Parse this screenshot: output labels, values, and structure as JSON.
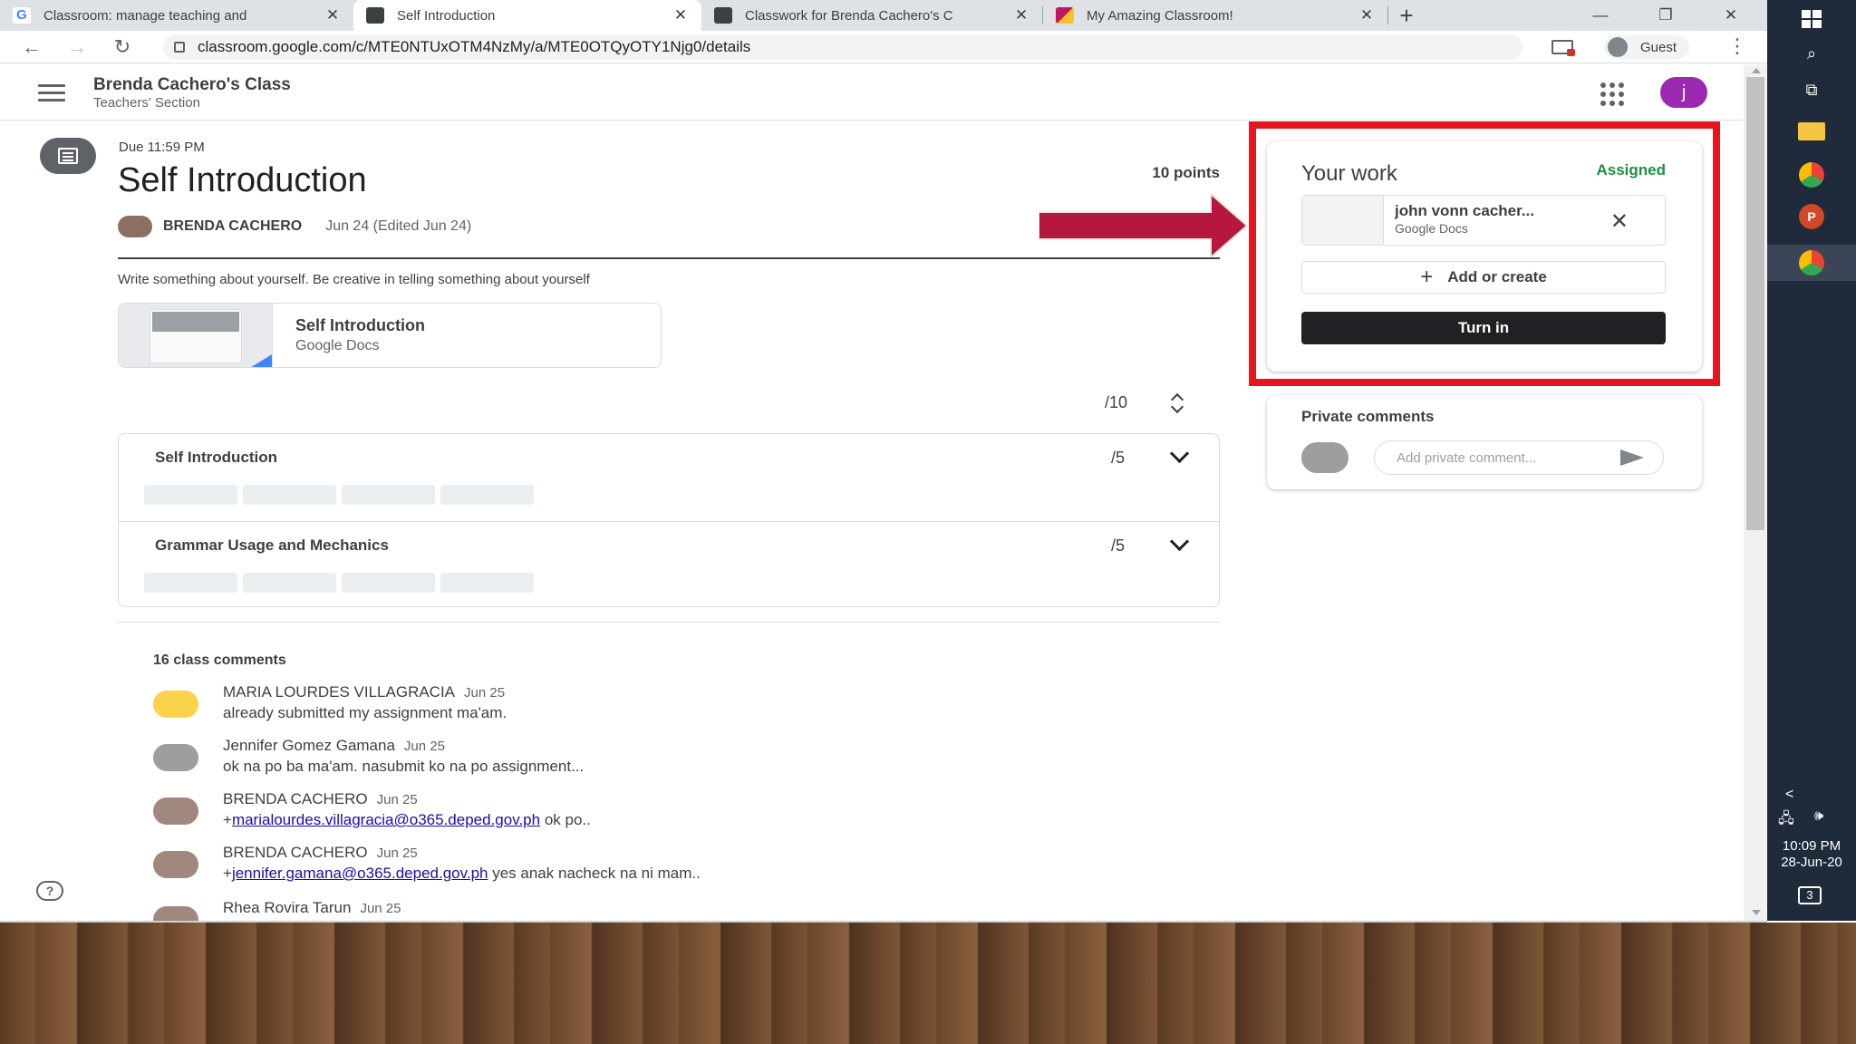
{
  "browser": {
    "tabs": [
      {
        "title": "Classroom: manage teaching and",
        "favicon_color": "#ffffff",
        "active": false
      },
      {
        "title": "Self Introduction",
        "favicon_color": "#3c4043",
        "active": true
      },
      {
        "title": "Classwork for Brenda Cachero's C",
        "favicon_color": "#3c4043",
        "active": false
      },
      {
        "title": "My Amazing Classroom!",
        "favicon_color": "#c2185b",
        "active": false
      }
    ],
    "new_tab_label": "+",
    "url": "classroom.google.com/c/MTE0NTUxOTM4NzMy/a/MTE0OTQyOTY1Njg0/details",
    "profile_label": "Guest"
  },
  "header": {
    "class_name": "Brenda Cachero's Class",
    "section": "Teachers' Section",
    "user_initial": "j"
  },
  "assignment": {
    "due": "Due 11:59 PM",
    "title": "Self Introduction",
    "points": "10 points",
    "teacher": "BRENDA CACHERO",
    "date": "Jun 24 (Edited Jun 24)",
    "description": "Write  something about yourself. Be creative in telling something about yourself",
    "attachment": {
      "title": "Self Introduction",
      "type": "Google Docs"
    },
    "rubric_total": "/10",
    "rubric": [
      {
        "title": "Self Introduction",
        "score": "/5"
      },
      {
        "title": "Grammar Usage and Mechanics",
        "score": "/5"
      }
    ]
  },
  "comments": {
    "count_label": "16 class comments",
    "items": [
      {
        "name": "MARIA LOURDES VILLAGRACIA",
        "date": "Jun 25",
        "prefix": "",
        "link": "",
        "text": "already submitted my assignment ma'am.",
        "avatar": "photo"
      },
      {
        "name": "Jennifer Gomez Gamana",
        "date": "Jun 25",
        "prefix": "",
        "link": "",
        "text": "ok na po ba ma'am. nasubmit ko na po assignment...",
        "avatar": "default"
      },
      {
        "name": "BRENDA CACHERO",
        "date": "Jun 25",
        "prefix": "+",
        "link": "marialourdes.villagracia@o365.deped.gov.ph",
        "text": " ok po..",
        "avatar": "photo"
      },
      {
        "name": "BRENDA CACHERO",
        "date": "Jun 25",
        "prefix": "+",
        "link": "jennifer.gamana@o365.deped.gov.ph",
        "text": " yes anak nacheck na ni mam..",
        "avatar": "photo"
      },
      {
        "name": "Rhea Rovira Tarun",
        "date": "Jun 25",
        "prefix": "",
        "link": "",
        "text": "",
        "avatar": "photo"
      }
    ]
  },
  "your_work": {
    "title": "Your work",
    "status": "Assigned",
    "file_name": "john vonn cacher...",
    "file_type": "Google Docs",
    "add_label": "Add or create",
    "turn_in_label": "Turn in"
  },
  "private_comments": {
    "title": "Private comments",
    "placeholder": "Add private comment..."
  },
  "taskbar": {
    "time": "10:09 PM",
    "date": "28-Jun-20",
    "notification_count": "3"
  },
  "colors": {
    "accent_purple": "#9c27b0",
    "assigned_green": "#1e8e3e",
    "highlight_red": "#e5141e",
    "arrow_crimson": "#b5173e"
  }
}
